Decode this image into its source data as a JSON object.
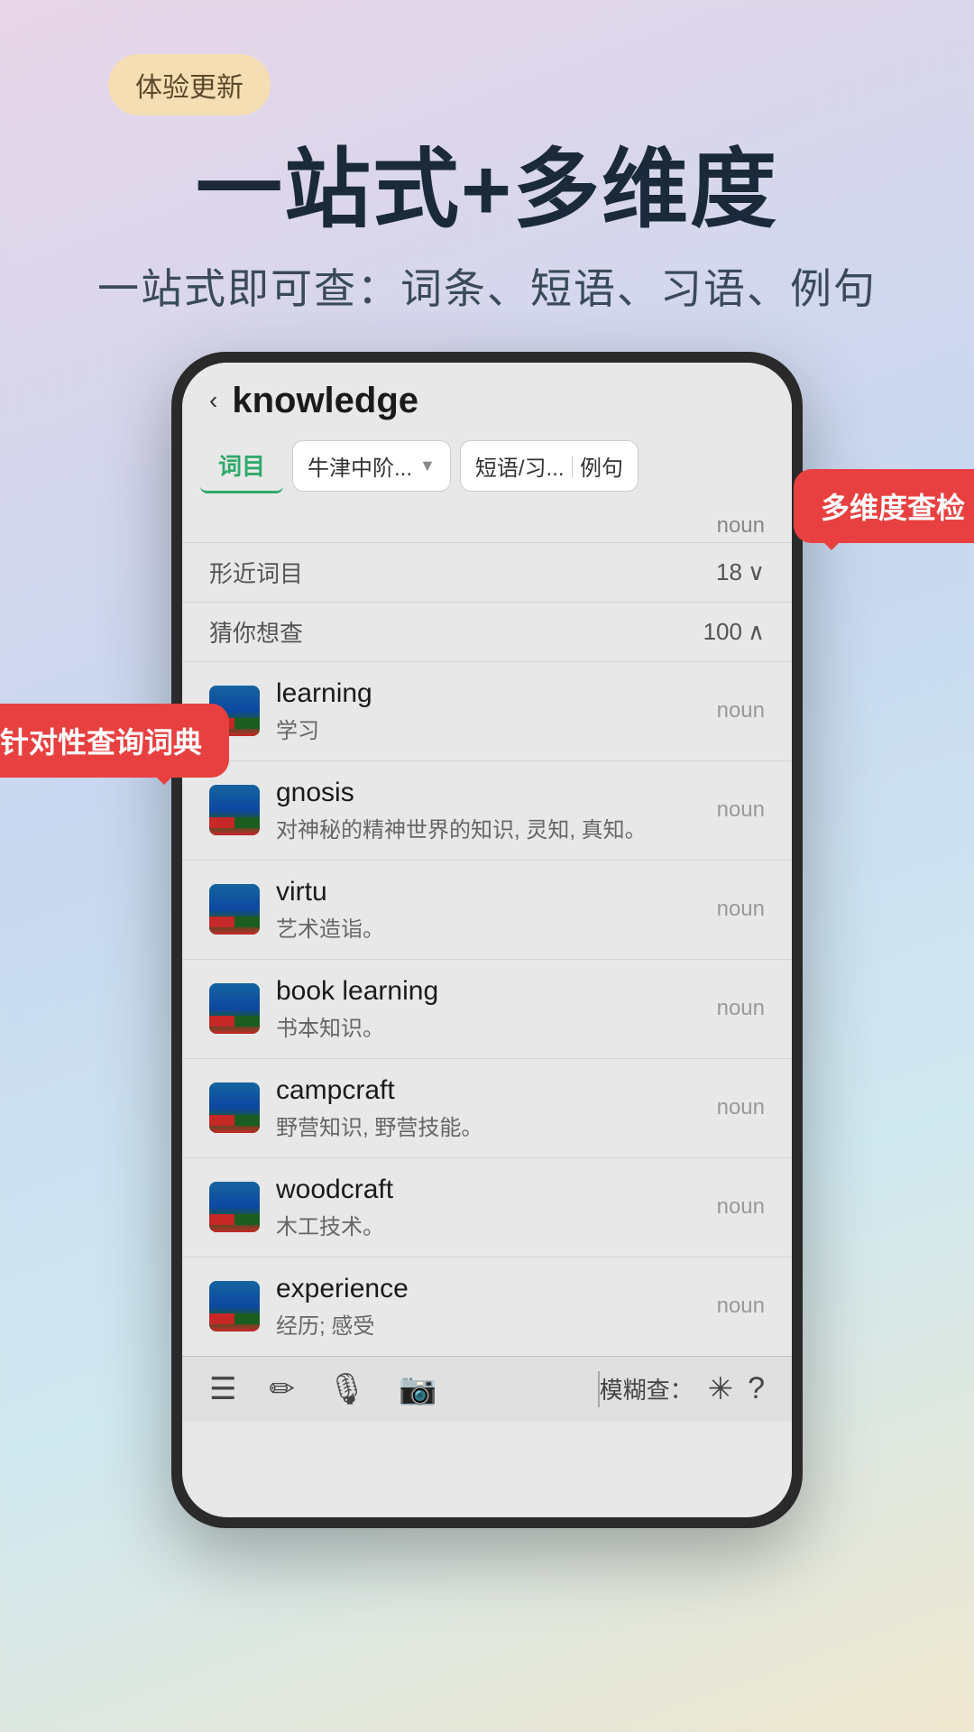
{
  "badge": {
    "label": "体验更新"
  },
  "hero": {
    "title": "一站式+多维度",
    "subtitle": "一站式即可查：词条、短语、习语、例句"
  },
  "tooltip1": {
    "label": "多维度查检"
  },
  "tooltip2": {
    "label": "针对性查询词典"
  },
  "phone": {
    "search_word": "knowledge",
    "back_label": "‹",
    "tabs": {
      "active": "词目",
      "dropdown_label": "牛津中阶...",
      "split_left": "短语/习...",
      "split_right": "例句"
    },
    "noun_label": "noun",
    "sections": {
      "similar": {
        "title": "形近词目",
        "count": "18",
        "expand": "∨"
      },
      "guess": {
        "title": "猜你想查",
        "count": "100",
        "collapse": "∧"
      }
    },
    "words": [
      {
        "english": "learning",
        "pos": "noun",
        "chinese": "学习"
      },
      {
        "english": "gnosis",
        "pos": "noun",
        "chinese": "对神秘的精神世界的知识, 灵知, 真知。"
      },
      {
        "english": "virtu",
        "pos": "noun",
        "chinese": "艺术造诣。"
      },
      {
        "english": "book learning",
        "pos": "noun",
        "chinese": "书本知识。"
      },
      {
        "english": "campcraft",
        "pos": "noun",
        "chinese": "野营知识, 野营技能。"
      },
      {
        "english": "woodcraft",
        "pos": "noun",
        "chinese": "木工技术。"
      },
      {
        "english": "experience",
        "pos": "noun",
        "chinese": "经历; 感受"
      }
    ],
    "toolbar": {
      "icons": [
        "≡≡",
        "✏",
        "🎤",
        "📷"
      ],
      "fuzzy_label": "模糊查：",
      "icon_ast": "✳",
      "icon_help": "?"
    }
  }
}
